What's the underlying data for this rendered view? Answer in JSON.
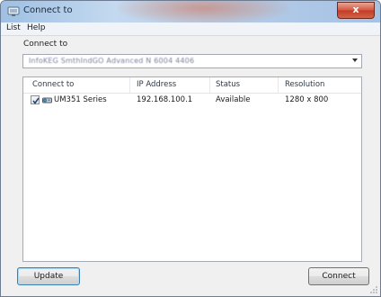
{
  "window": {
    "title": "Connect to",
    "close_glyph": "x"
  },
  "menu": {
    "items": [
      "List",
      "Help"
    ]
  },
  "form": {
    "label": "Connect to",
    "combo_value": "InfoKEG SmthIndGO Advanced N 6004 4406",
    "combo_arrow": "chevron-down-icon"
  },
  "table": {
    "columns": [
      "Connect to",
      "IP Address",
      "Status",
      "Resolution"
    ],
    "rows": [
      {
        "checked": true,
        "name": "UM351 Series",
        "ip": "192.168.100.1",
        "status": "Available",
        "resolution": "1280 x 800"
      }
    ]
  },
  "buttons": {
    "update": "Update",
    "connect": "Connect"
  },
  "colors": {
    "close_red": "#c23b23",
    "title_blue": "#a6c2e4",
    "focus_blue": "#3c7fb1"
  }
}
